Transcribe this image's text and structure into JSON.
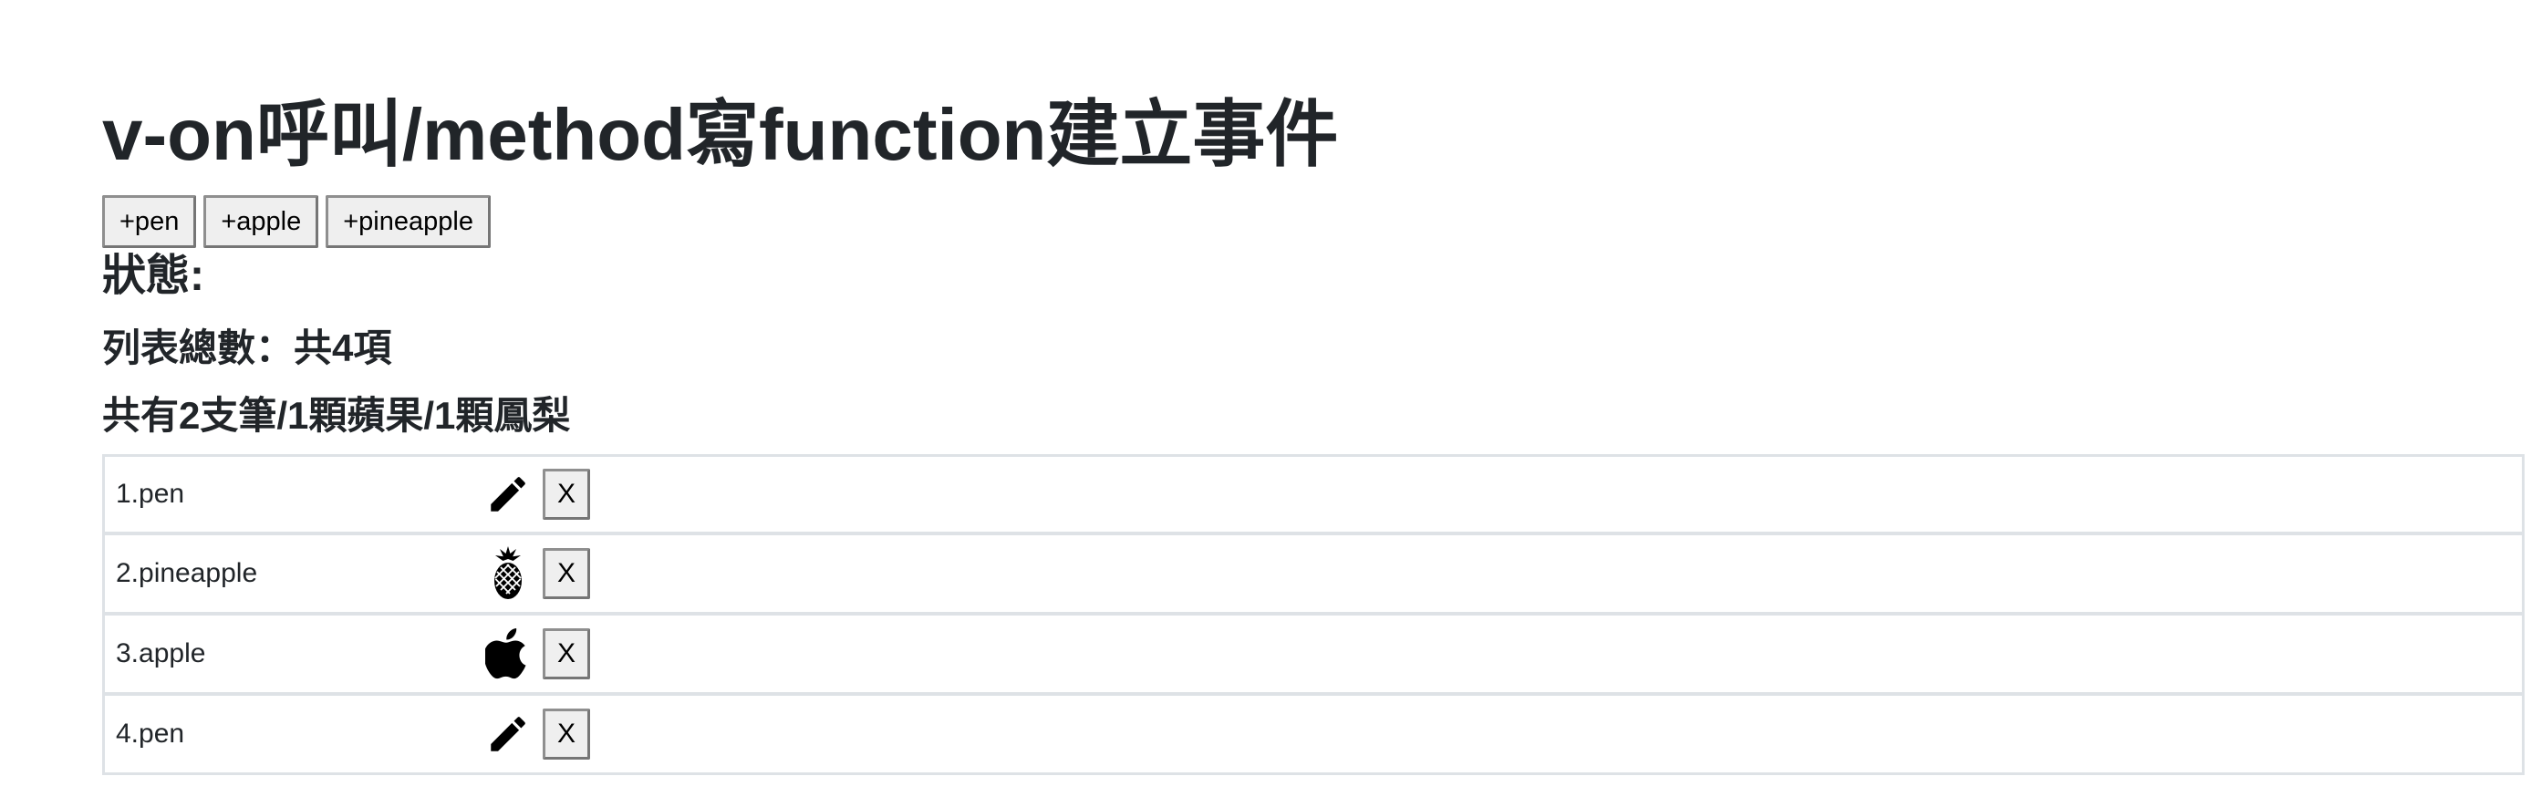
{
  "page": {
    "title": "v-on呼叫/method寫function建立事件"
  },
  "add_buttons": [
    {
      "label": "+pen"
    },
    {
      "label": "+apple"
    },
    {
      "label": "+pineapple"
    }
  ],
  "status": {
    "heading": "狀態:",
    "total_text": "列表總數：共4項",
    "counts_text": "共有2支筆/1顆蘋果/1顆鳳梨"
  },
  "items": [
    {
      "label": "1.pen",
      "icon": "pencil-icon",
      "remove_label": "X"
    },
    {
      "label": "2.pineapple",
      "icon": "pineapple-icon",
      "remove_label": "X"
    },
    {
      "label": "3.apple",
      "icon": "apple-icon",
      "remove_label": "X"
    },
    {
      "label": "4.pen",
      "icon": "pencil-icon",
      "remove_label": "X"
    }
  ]
}
